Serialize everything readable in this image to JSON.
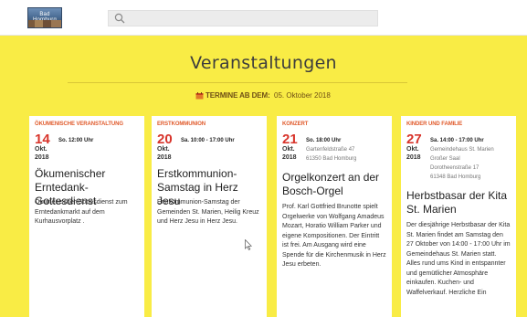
{
  "header": {
    "logo_text": "Bad Homburg",
    "search": {
      "value": "",
      "placeholder": ""
    }
  },
  "page": {
    "title": "Veranstaltungen",
    "date_label": "TERMINE AB DEM:",
    "date_value": "05. Oktober 2018"
  },
  "colors": {
    "background": "#f9ec45",
    "category": "#e05a2b",
    "day": "#d8342b"
  },
  "events": [
    {
      "category": "ÖKUMENISCHE VERANSTALTUNG",
      "day": "14",
      "month": "Okt.",
      "year": "2018",
      "time": "So. 12:00 Uhr",
      "location_lines": [],
      "title": "Ökumenischer Erntedank-Gottesdienst",
      "description": "Ökumenischer Gottesdienst zum Erntedankmarkt auf dem Kurhausvorplatz ."
    },
    {
      "category": "ERSTKOMMUNION",
      "day": "20",
      "month": "Okt.",
      "year": "2018",
      "time": "Sa. 10:00 - 17:00 Uhr",
      "location_lines": [],
      "title": "Erstkommunion-Samstag in Herz Jesu",
      "description": "Erstkommunion-Samstag der Gemeinden St. Marien, Heilig Kreuz und Herz Jesu in Herz Jesu."
    },
    {
      "category": "KONZERT",
      "day": "21",
      "month": "Okt.",
      "year": "2018",
      "time": "So. 18:00 Uhr",
      "location_lines": [
        "Gartenfeldstraße 47",
        "61350 Bad Homburg"
      ],
      "title": "Orgelkonzert an der Bosch-Orgel",
      "description": "Prof. Karl Gottfried Brunotte spielt Orgelwerke von Wolfgang Amadeus Mozart, Horatio William Parker und eigene Kompositionen. Der Eintritt ist frei. Am Ausgang wird eine Spende für die Kirchenmusik in Herz Jesu erbeten."
    },
    {
      "category": "KINDER UND FAMILIE",
      "day": "27",
      "month": "Okt.",
      "year": "2018",
      "time": "Sa. 14:00 - 17:00 Uhr",
      "location_lines": [
        "Gemeindehaus St. Marien",
        "Großer Saal",
        "Dorotheenstraße 17",
        "61348 Bad Homburg"
      ],
      "title": "Herbstbasar der Kita St. Marien",
      "description": "Der diesjährige Herbstbasar der Kita St. Marien findet am Samstag den 27 Oktober von 14:00 - 17:00 Uhr im Gemeindehaus St. Marien statt. Alles rund ums Kind in entspannter und gemütlicher Atmosphäre einkaufen. Kuchen- und Waffelverkauf. Herzliche Ein"
    }
  ]
}
